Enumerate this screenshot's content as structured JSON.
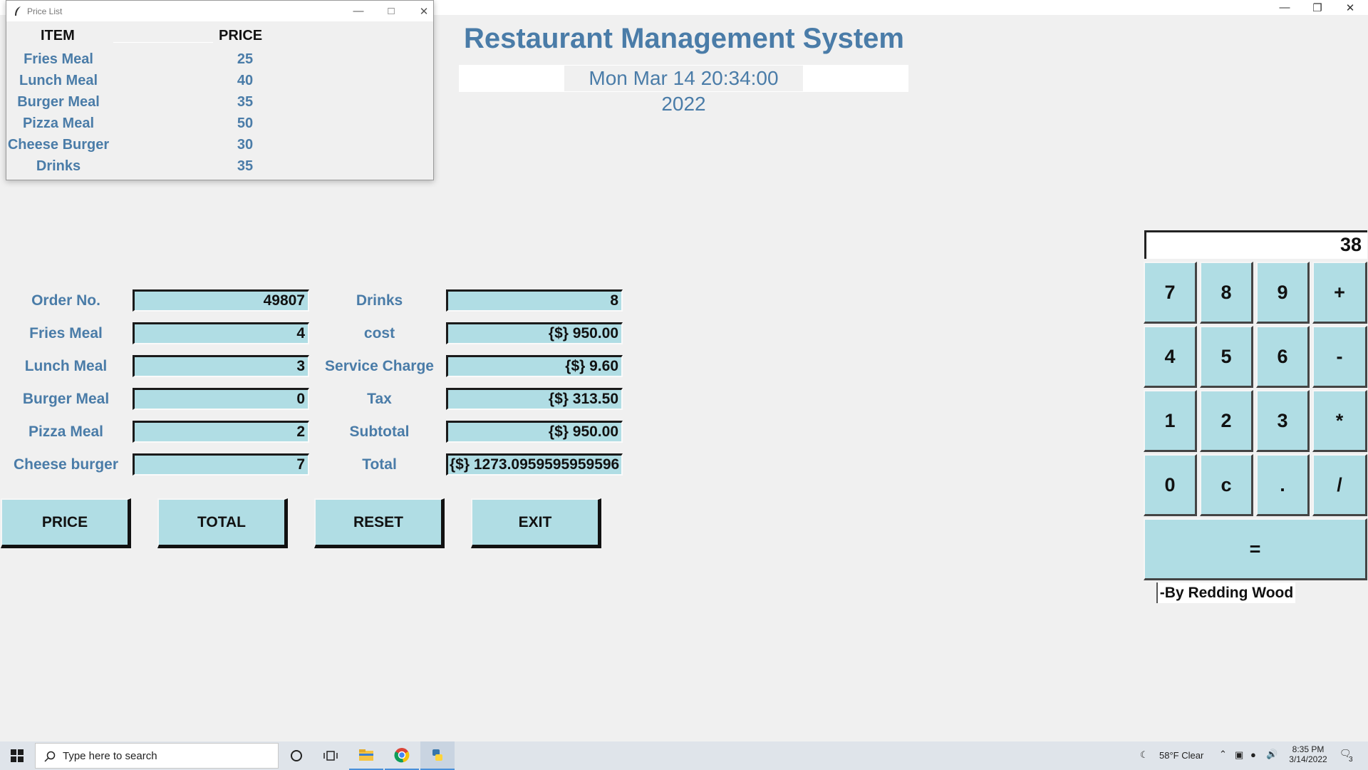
{
  "price_window": {
    "title": "Price List",
    "header_item": "ITEM",
    "header_price": "PRICE",
    "items": [
      {
        "name": "Fries Meal",
        "price": "25"
      },
      {
        "name": "Lunch Meal",
        "price": "40"
      },
      {
        "name": "Burger Meal",
        "price": "35"
      },
      {
        "name": "Pizza Meal",
        "price": "50"
      },
      {
        "name": "Cheese Burger",
        "price": "30"
      },
      {
        "name": "Drinks",
        "price": "35"
      }
    ]
  },
  "header": {
    "title": "Restaurant Management System",
    "datetime": "Mon Mar 14 20:34:00 2022"
  },
  "form": {
    "left": [
      {
        "label": "Order No.",
        "value": "49807"
      },
      {
        "label": "Fries Meal",
        "value": "4"
      },
      {
        "label": "Lunch Meal",
        "value": "3"
      },
      {
        "label": "Burger Meal",
        "value": "0"
      },
      {
        "label": "Pizza Meal",
        "value": "2"
      },
      {
        "label": "Cheese burger",
        "value": "7"
      }
    ],
    "right": [
      {
        "label": "Drinks",
        "value": "8"
      },
      {
        "label": "cost",
        "value": "{$} 950.00"
      },
      {
        "label": "Service Charge",
        "value": "{$} 9.60"
      },
      {
        "label": "Tax",
        "value": "{$} 313.50"
      },
      {
        "label": "Subtotal",
        "value": "{$} 950.00"
      },
      {
        "label": "Total",
        "value": "{$} 1273.0959595959596"
      }
    ]
  },
  "actions": {
    "price": "PRICE",
    "total": "TOTAL",
    "reset": "RESET",
    "exit": "EXIT"
  },
  "calculator": {
    "display": "38",
    "keys": [
      [
        "7",
        "8",
        "9",
        "+"
      ],
      [
        "4",
        "5",
        "6",
        "-"
      ],
      [
        "1",
        "2",
        "3",
        "*"
      ],
      [
        "0",
        "c",
        ".",
        "/"
      ]
    ],
    "equals": "=",
    "credit": "-By Redding Wood"
  },
  "taskbar": {
    "search_placeholder": "Type here to search",
    "weather": "58°F  Clear",
    "time": "8:35 PM",
    "date": "3/14/2022",
    "notifications": "3"
  },
  "colors": {
    "accent_text": "#4a7ca8",
    "entry_bg": "#b0dde4"
  }
}
